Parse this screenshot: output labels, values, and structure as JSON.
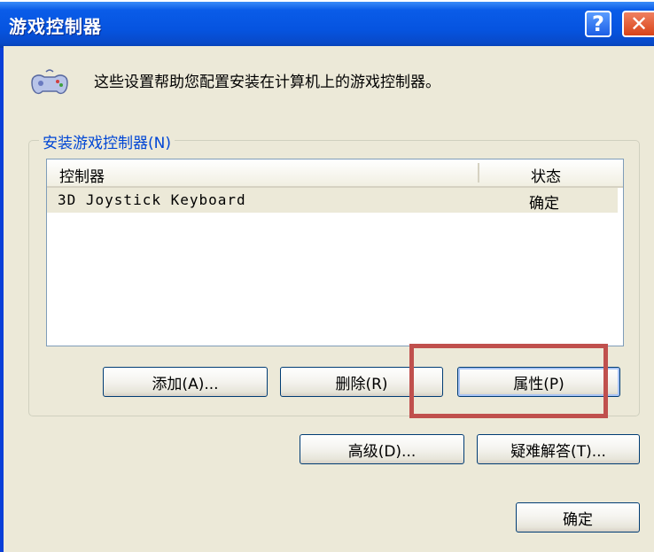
{
  "window": {
    "title": "游戏控制器",
    "help_label": "?",
    "close_label": "✕"
  },
  "header": {
    "icon": "gamepad-icon",
    "description": "这些设置帮助您配置安装在计算机上的游戏控制器。"
  },
  "group": {
    "label": "安装游戏控制器(N)",
    "columns": [
      "控制器",
      "状态"
    ],
    "rows": [
      {
        "controller": "3D Joystick Keyboard",
        "status": "确定"
      }
    ]
  },
  "buttons": {
    "add": "添加(A)...",
    "remove": "删除(R)",
    "properties": "属性(P)",
    "advanced": "高级(D)...",
    "troubleshoot": "疑难解答(T)...",
    "ok": "确定"
  },
  "colors": {
    "titlebar": "#0654e0",
    "dialog_bg": "#ece9d8",
    "group_label": "#0046d5",
    "highlight": "#c0504d"
  }
}
